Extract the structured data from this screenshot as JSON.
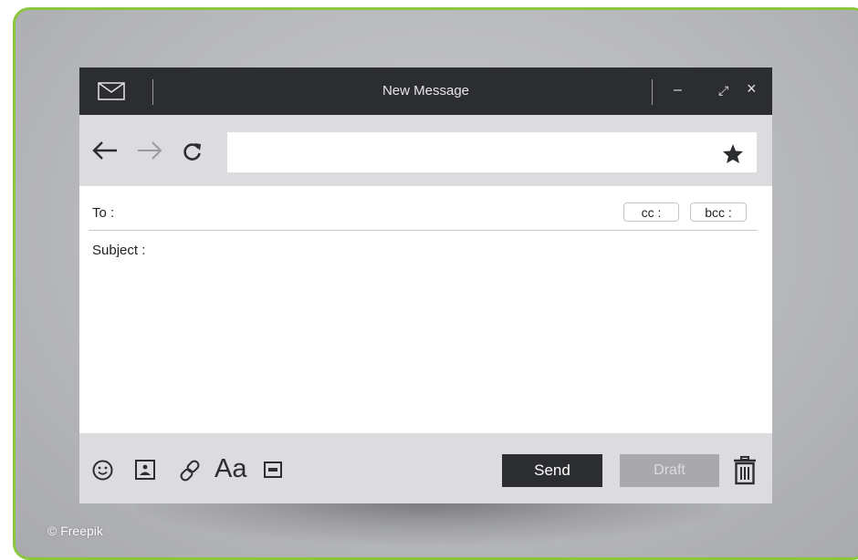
{
  "window": {
    "title": "New Message",
    "title_icon": "mail-icon",
    "controls": {
      "minimize": "–",
      "maximize": "⤢",
      "close": "×"
    }
  },
  "nav": {
    "back_icon": "arrow-left-icon",
    "forward_icon": "arrow-right-icon",
    "reload_icon": "reload-icon",
    "address_value": "",
    "bookmark_icon": "star-icon"
  },
  "compose": {
    "to_label": "To :",
    "cc_label": "cc :",
    "bcc_label": "bcc :",
    "subject_label": "Subject :",
    "body_value": ""
  },
  "toolbar": {
    "format_label": "Aa",
    "send_label": "Send",
    "draft_label": "Draft",
    "icons": [
      "smiley-icon",
      "image-icon",
      "link-icon",
      "gif-icon",
      "trash-icon"
    ]
  },
  "credit": "© Freepik",
  "colors": {
    "frame_border": "#8cc63f",
    "titlebar": "#2c2d30",
    "bar_gray": "#dcdcdf",
    "send_bg": "#2c2d30",
    "draft_bg": "#a9a9ad"
  }
}
